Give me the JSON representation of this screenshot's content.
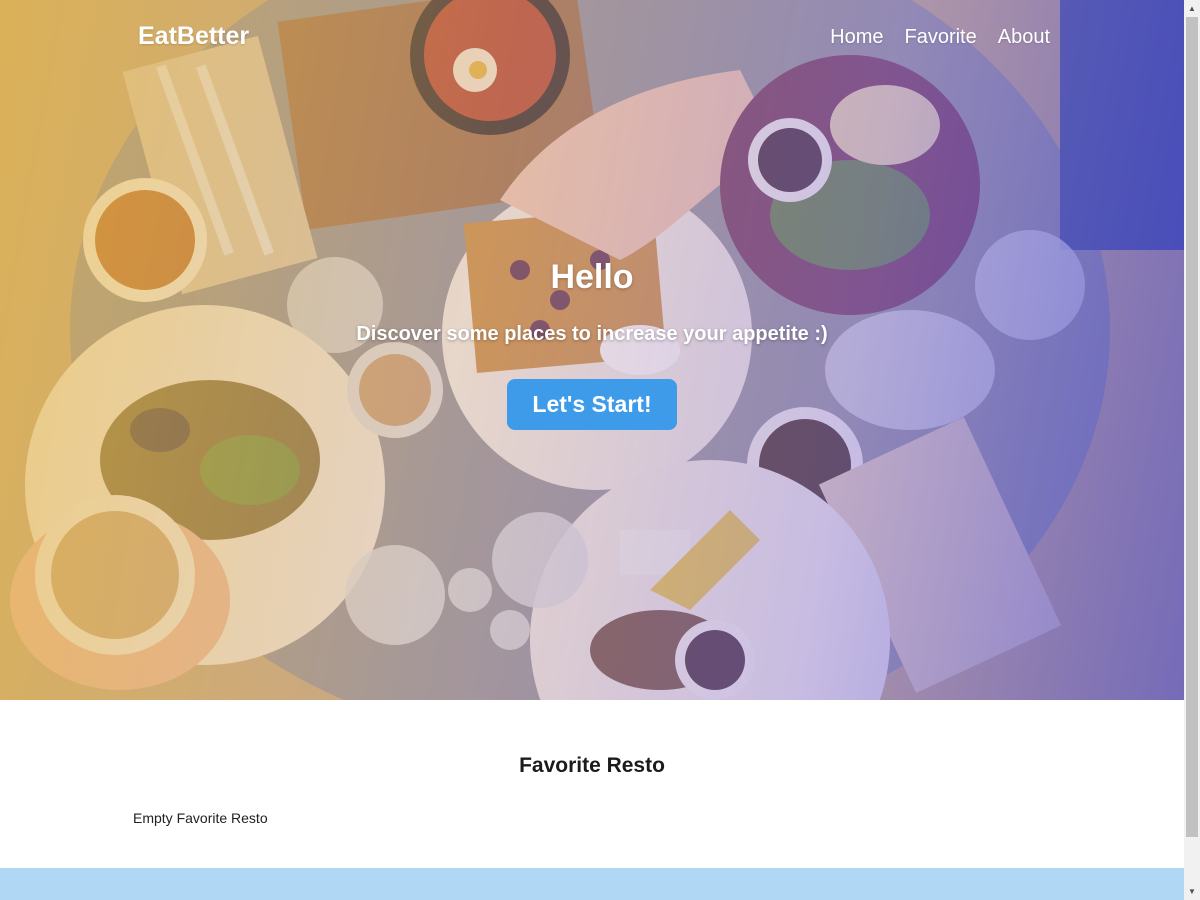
{
  "navbar": {
    "brand": "EatBetter",
    "links": [
      {
        "label": "Home"
      },
      {
        "label": "Favorite"
      },
      {
        "label": "About"
      }
    ]
  },
  "hero": {
    "title": "Hello",
    "subtitle": "Discover some places to increase your appetite :)",
    "cta_label": "Let's Start!"
  },
  "favorites": {
    "title": "Favorite Resto",
    "empty_message": "Empty Favorite Resto"
  },
  "colors": {
    "cta": "#3d9be9",
    "footer": "#b0d7f3",
    "overlay_left": "#eab840",
    "overlay_right": "#4646dc"
  },
  "icons": {
    "scroll_up": "scroll-up-arrow-icon",
    "scroll_down": "scroll-down-arrow-icon"
  }
}
